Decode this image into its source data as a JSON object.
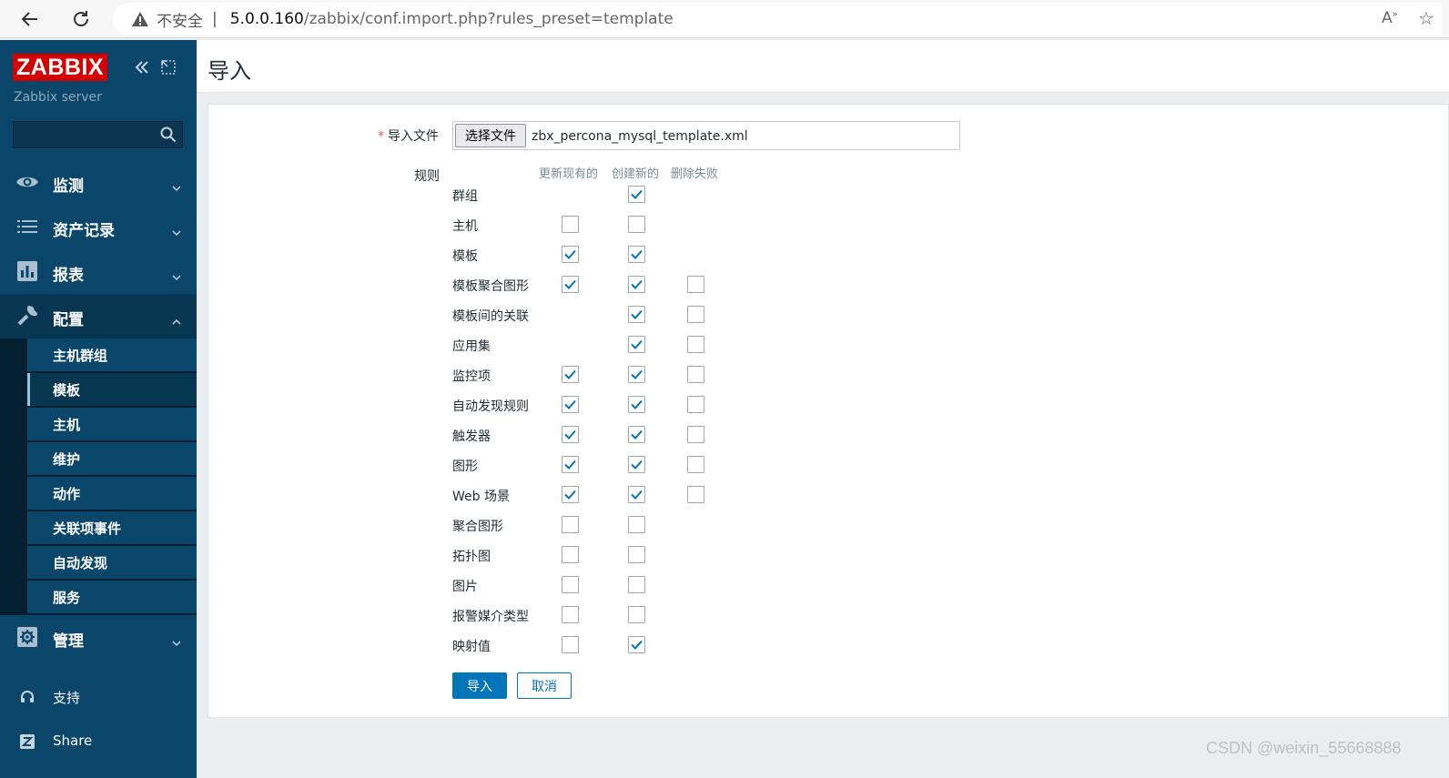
{
  "browser": {
    "insecure_label": "不安全",
    "separator": "|",
    "url_host": "5.0.0.160",
    "url_path": "/zabbix/conf.import.php?rules_preset=template",
    "read_aloud_icon": "read-aloud-icon",
    "favorite_icon": "favorite-star-icon"
  },
  "sidebar": {
    "logo": "ZABBIX",
    "server_name": "Zabbix server",
    "search_placeholder": "",
    "menu": [
      {
        "label": "监测",
        "icon": "eye-icon"
      },
      {
        "label": "资产记录",
        "icon": "list-icon"
      },
      {
        "label": "报表",
        "icon": "bar-chart-icon"
      },
      {
        "label": "配置",
        "icon": "wrench-icon"
      }
    ],
    "submenu": [
      "主机群组",
      "模板",
      "主机",
      "维护",
      "动作",
      "关联项事件",
      "自动发现",
      "服务"
    ],
    "admin": {
      "label": "管理",
      "icon": "gear-icon"
    },
    "support": "支持",
    "share": "Share"
  },
  "page": {
    "title": "导入"
  },
  "form": {
    "file_label": "导入文件",
    "required_mark": "*",
    "file_button": "选择文件",
    "file_name": "zbx_percona_mysql_template.xml",
    "rules_label": "规则",
    "columns": [
      "更新现有的",
      "创建新的",
      "删除失败"
    ],
    "rules": [
      {
        "label": "群组",
        "update": null,
        "create": true,
        "delete": null
      },
      {
        "label": "主机",
        "update": false,
        "create": false,
        "delete": null
      },
      {
        "label": "模板",
        "update": true,
        "create": true,
        "delete": null
      },
      {
        "label": "模板聚合图形",
        "update": true,
        "create": true,
        "delete": false
      },
      {
        "label": "模板间的关联",
        "update": null,
        "create": true,
        "delete": false
      },
      {
        "label": "应用集",
        "update": null,
        "create": true,
        "delete": false
      },
      {
        "label": "监控项",
        "update": true,
        "create": true,
        "delete": false
      },
      {
        "label": "自动发现规则",
        "update": true,
        "create": true,
        "delete": false
      },
      {
        "label": "触发器",
        "update": true,
        "create": true,
        "delete": false
      },
      {
        "label": "图形",
        "update": true,
        "create": true,
        "delete": false
      },
      {
        "label": "Web 场景",
        "update": true,
        "create": true,
        "delete": false
      },
      {
        "label": "聚合图形",
        "update": false,
        "create": false,
        "delete": null
      },
      {
        "label": "拓扑图",
        "update": false,
        "create": false,
        "delete": null
      },
      {
        "label": "图片",
        "update": false,
        "create": false,
        "delete": null
      },
      {
        "label": "报警媒介类型",
        "update": false,
        "create": false,
        "delete": null
      },
      {
        "label": "映射值",
        "update": false,
        "create": true,
        "delete": null
      }
    ],
    "import_button": "导入",
    "cancel_button": "取消"
  },
  "watermark": "CSDN @weixin_55668888",
  "colors": {
    "sidebar": "#0a466a",
    "logo": "#d40000",
    "primary": "#0275b8",
    "check": "#0275b8"
  }
}
